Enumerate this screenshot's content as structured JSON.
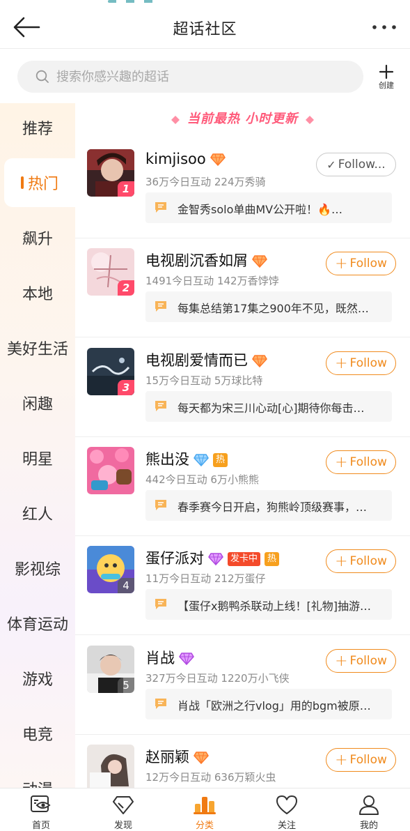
{
  "header": {
    "title": "超话社区"
  },
  "search": {
    "placeholder": "搜索你感兴趣的超话",
    "create_label": "创建"
  },
  "sidebar": {
    "items": [
      {
        "label": "推荐",
        "active": false
      },
      {
        "label": "热门",
        "active": true
      },
      {
        "label": "飙升",
        "active": false
      },
      {
        "label": "本地",
        "active": false
      },
      {
        "label": "美好生活",
        "active": false
      },
      {
        "label": "闲趣",
        "active": false
      },
      {
        "label": "明星",
        "active": false
      },
      {
        "label": "红人",
        "active": false
      },
      {
        "label": "影视综",
        "active": false
      },
      {
        "label": "体育运动",
        "active": false
      },
      {
        "label": "游戏",
        "active": false
      },
      {
        "label": "电竞",
        "active": false
      },
      {
        "label": "动漫",
        "active": false
      }
    ]
  },
  "banner": {
    "text": "当前最热 小时更新"
  },
  "topics": [
    {
      "rank": "1",
      "name": "kimjisoo",
      "stats": "36万今日互动 224万秀骑",
      "post": "金智秀solo单曲MV公开啦！🔥…",
      "follow_label": "Follow...",
      "followed": true,
      "badges": [
        "diamond-orange"
      ],
      "tags": []
    },
    {
      "rank": "2",
      "name": "电视剧沉香如屑",
      "stats": "1491今日互动 142万香饽饽",
      "post": "每集总结第17集之900年不见，既然…",
      "follow_label": "Follow",
      "followed": false,
      "badges": [
        "diamond-orange"
      ],
      "tags": []
    },
    {
      "rank": "3",
      "name": "电视剧爱情而已",
      "stats": "15万今日互动 5万球比特",
      "post": "每天都为宋三川心动[心]期待你每击…",
      "follow_label": "Follow",
      "followed": false,
      "badges": [
        "diamond-orange"
      ],
      "tags": []
    },
    {
      "rank": "",
      "name": "熊出没",
      "stats": "442今日互动 6万小熊熊",
      "post": "春季赛今日开启，狗熊岭顶级赛事，…",
      "follow_label": "Follow",
      "followed": false,
      "badges": [
        "diamond-blue"
      ],
      "tags": [
        "热"
      ]
    },
    {
      "rank": "4",
      "name": "蛋仔派对",
      "stats": "11万今日互动 212万蛋仔",
      "post": "【蛋仔x鹅鸭杀联动上线！[礼物]抽游…",
      "follow_label": "Follow",
      "followed": false,
      "badges": [
        "diamond-purple"
      ],
      "tags": [
        "发卡中",
        "热"
      ]
    },
    {
      "rank": "5",
      "name": "肖战",
      "stats": "327万今日互动 1220万小飞侠",
      "post": "肖战「欧洲之行vlog」用的bgm被原…",
      "follow_label": "Follow",
      "followed": false,
      "badges": [
        "diamond-purple"
      ],
      "tags": []
    },
    {
      "rank": "",
      "name": "赵丽颖",
      "stats": "12万今日互动 636万颖火虫",
      "post": "",
      "follow_label": "Follow",
      "followed": false,
      "badges": [
        "diamond-orange"
      ],
      "tags": []
    }
  ],
  "tabs": [
    {
      "label": "首页",
      "icon": "eye-screen-icon",
      "active": false
    },
    {
      "label": "发现",
      "icon": "diamond-outline-icon",
      "active": false
    },
    {
      "label": "分类",
      "icon": "bars-icon",
      "active": true
    },
    {
      "label": "关注",
      "icon": "heart-outline-icon",
      "active": false
    },
    {
      "label": "我的",
      "icon": "person-icon",
      "active": false
    }
  ],
  "colors": {
    "accent": "#f07a12",
    "rank_top": "#ff4a6a",
    "banner": "#ff5a7a"
  }
}
